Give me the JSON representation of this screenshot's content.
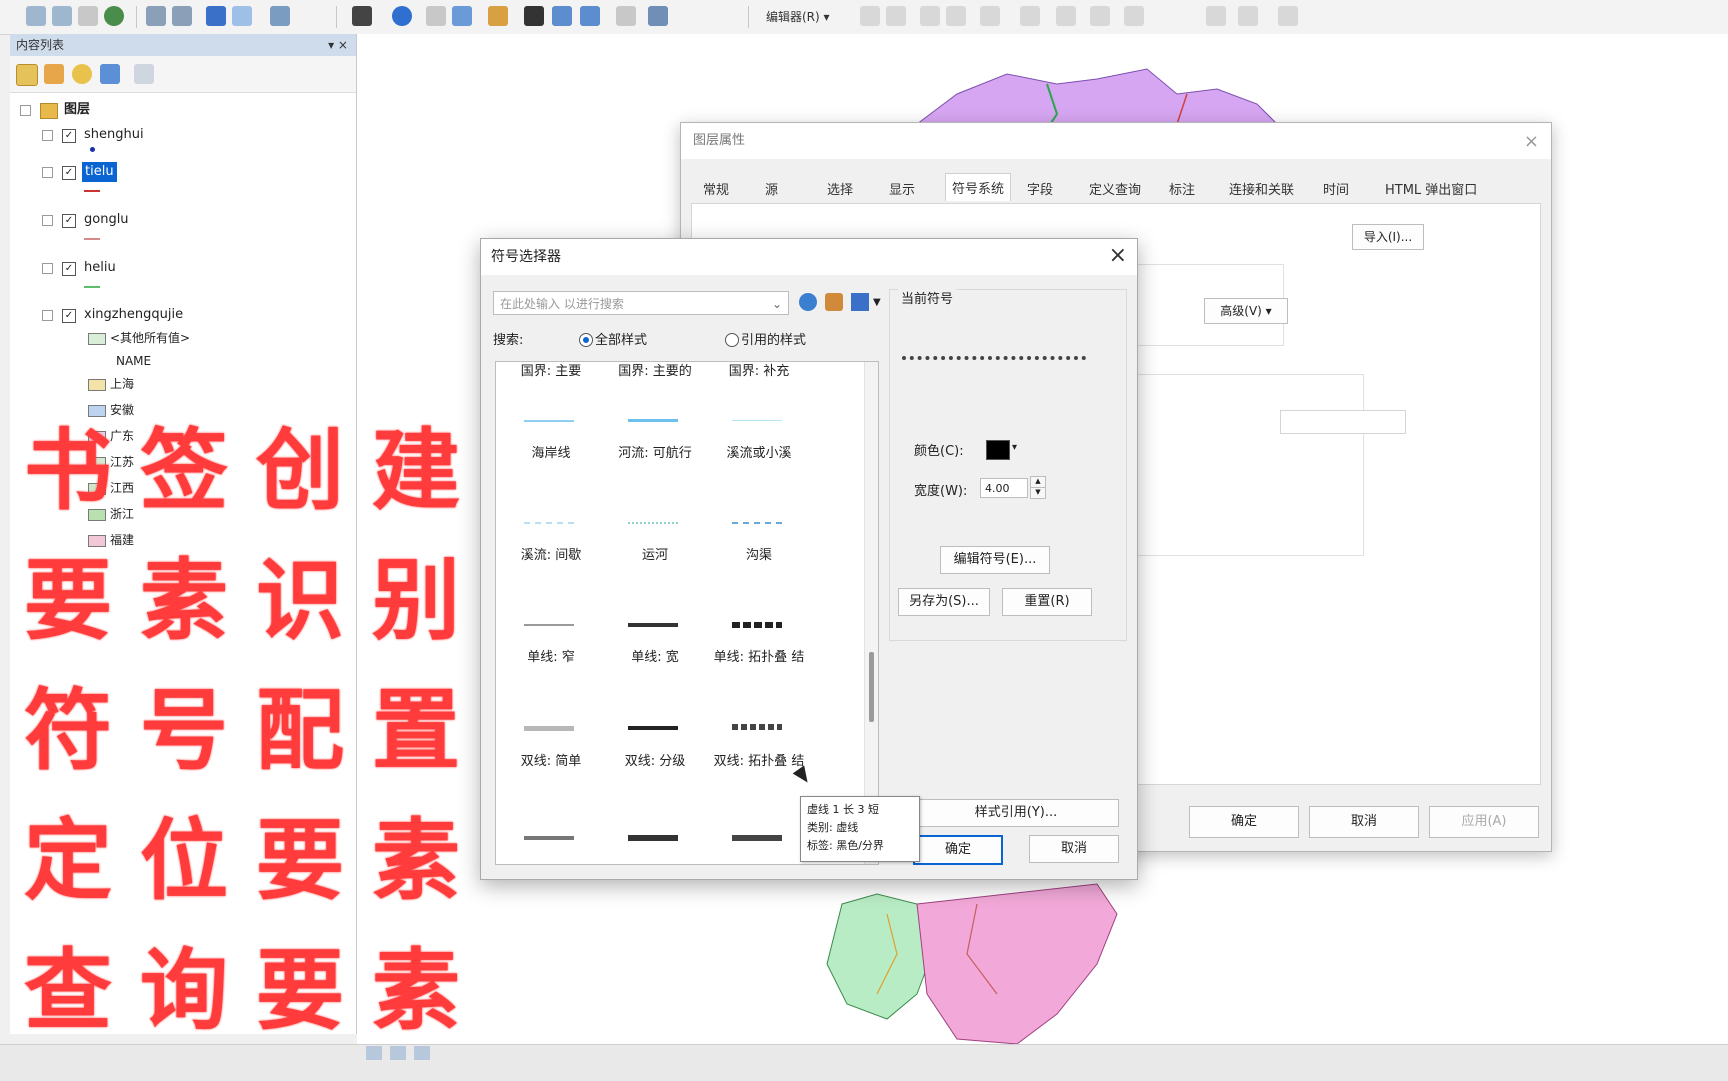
{
  "toolbar": {
    "editor_dropdown": "编辑器(R) ▾"
  },
  "toc": {
    "title": "内容列表",
    "window_controls": "▾ ×",
    "root_group": "图层",
    "layers": [
      "shenghui",
      "tielu",
      "gonglu",
      "heliu",
      "xingzhengqujie"
    ],
    "sub_legend": [
      "<其他所有值>",
      "NAME",
      "上海",
      "安徽",
      "广东",
      "江苏",
      "江西",
      "浙江",
      "福建"
    ]
  },
  "layer_props": {
    "title": "图层属性",
    "tabs": [
      "常规",
      "源",
      "选择",
      "显示",
      "符号系统",
      "字段",
      "定义查询",
      "标注",
      "连接和关联",
      "时间",
      "HTML 弹出窗口"
    ],
    "import_button": "导入(I)...",
    "advanced_button": "高级(V) ▾",
    "ok": "确定",
    "cancel": "取消",
    "apply": "应用(A)"
  },
  "symbol_selector": {
    "title": "符号选择器",
    "search_placeholder": "在此处输入 以进行搜索",
    "scope_label": "搜索:",
    "scope_all": "全部样式",
    "scope_referenced": "引用的样式",
    "symbols": [
      {
        "label": "国界: 主要"
      },
      {
        "label": "国界: 主要的"
      },
      {
        "label": "国界: 补充"
      },
      {
        "label": "海岸线"
      },
      {
        "label": "河流: 可航行"
      },
      {
        "label": "溪流或小溪"
      },
      {
        "label": "溪流: 间歇"
      },
      {
        "label": "运河"
      },
      {
        "label": "沟渠"
      },
      {
        "label": "单线: 窄"
      },
      {
        "label": "单线: 宽"
      },
      {
        "label": "单线: 拓扑叠 结"
      },
      {
        "label": "双线: 简单"
      },
      {
        "label": "双线: 分级"
      },
      {
        "label": "双线: 拓扑叠 结"
      },
      {
        "label": ""
      },
      {
        "label": ""
      },
      {
        "label": ""
      }
    ],
    "current_symbol_label": "当前符号",
    "color_label": "颜色(C):",
    "width_label": "宽度(W):",
    "width_value": "4.00",
    "edit_symbol_button": "编辑符号(E)...",
    "save_as_button": "另存为(S)...",
    "reset_button": "重置(R)",
    "style_refs_button": "样式引用(Y)...",
    "ok": "确定",
    "cancel": "取消",
    "tooltip_lines": [
      "虚线 1 长 3 短",
      "类别: 虚线",
      "标签: 黑色/分界"
    ]
  },
  "overlay": {
    "lines": [
      "书签创建",
      "要素识别",
      "符号配置",
      "定位要素",
      "查询要素"
    ],
    "color": "#ff3b3b"
  }
}
